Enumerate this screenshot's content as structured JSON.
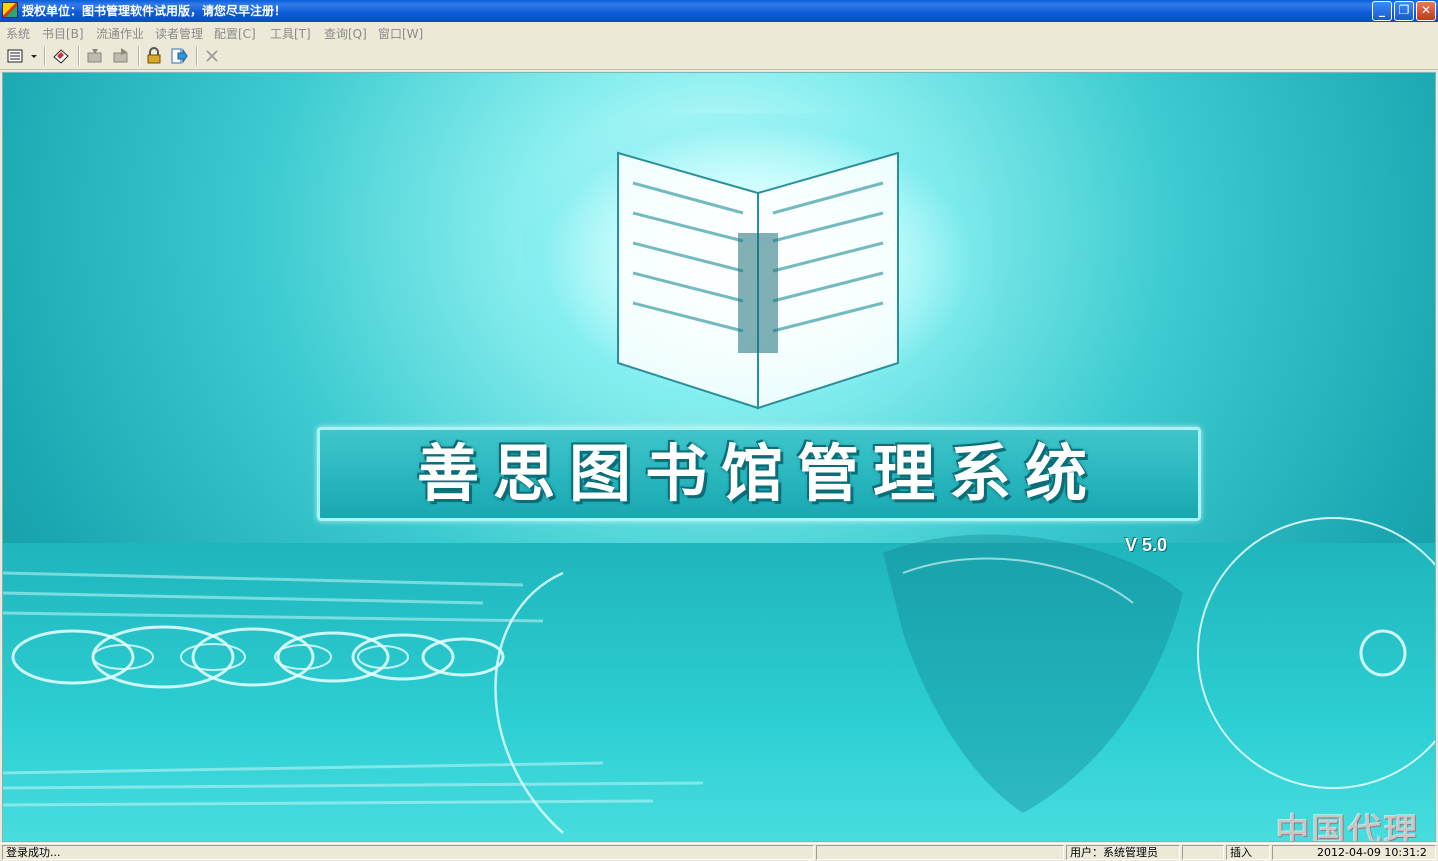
{
  "window": {
    "title": "授权单位：图书管理软件试用版，请您尽早注册！",
    "minimize_glyph": "_",
    "restore_glyph": "❐",
    "close_glyph": "✕"
  },
  "menu": [
    {
      "label": "系统"
    },
    {
      "label": "书目[B]"
    },
    {
      "label": "流通作业"
    },
    {
      "label": "读者管理"
    },
    {
      "label": "配置[C]"
    },
    {
      "label": "工具[T]"
    },
    {
      "label": "查询[Q]"
    },
    {
      "label": "窗口[W]"
    }
  ],
  "toolbar": {
    "items": [
      "list-dropdown-icon",
      "eraser-icon",
      "import-icon",
      "export-icon",
      "lock-icon",
      "exit-icon",
      "close-icon"
    ]
  },
  "splash": {
    "banner_title": "善思图书馆管理系统",
    "version": "V 5.0",
    "watermark": "中国代理网"
  },
  "colors": {
    "background_teal": "#1aa6b0",
    "title_bar_blue": "#0b4bc2"
  },
  "status": {
    "message": "登录成功...",
    "user": "用户：系统管理员",
    "mode": "插入",
    "datetime": "2012-04-09 10:31:2"
  }
}
